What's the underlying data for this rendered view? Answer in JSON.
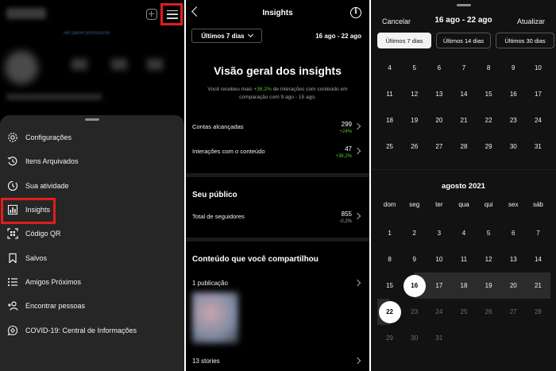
{
  "menu": {
    "items": [
      {
        "label": "Configurações",
        "icon": "settings-icon"
      },
      {
        "label": "Itens Arquivados",
        "icon": "archive-icon"
      },
      {
        "label": "Sua atividade",
        "icon": "activity-icon"
      },
      {
        "label": "Insights",
        "icon": "insights-icon"
      },
      {
        "label": "Código QR",
        "icon": "qr-code-icon"
      },
      {
        "label": "Salvos",
        "icon": "bookmark-icon"
      },
      {
        "label": "Amigos Próximos",
        "icon": "close-friends-icon"
      },
      {
        "label": "Encontrar pessoas",
        "icon": "add-person-icon"
      },
      {
        "label": "COVID-19: Central de Informações",
        "icon": "covid-info-icon"
      }
    ]
  },
  "insights": {
    "title": "Insights",
    "range_button": "Últimos 7 dias",
    "range_dates": "16 ago - 22 ago",
    "overview_title": "Visão geral dos insights",
    "overview_desc_pre": "Você recebeu mais ",
    "overview_desc_pct": "+38,2%",
    "overview_desc_post": " de interações com conteúdo em comparação com 9 ago - 15 ago.",
    "accounts_reached": {
      "label": "Contas alcançadas",
      "value": "299",
      "delta": "+24%"
    },
    "content_interactions": {
      "label": "Interações com o conteúdo",
      "value": "47",
      "delta": "+38,2%"
    },
    "audience_title": "Seu público",
    "followers": {
      "label": "Total de seguidores",
      "value": "855",
      "delta": "-0,2%"
    },
    "shared_title": "Conteúdo que você compartilhou",
    "posts_label": "1 publicação",
    "stories_label": "13 stories"
  },
  "date_picker": {
    "cancel": "Cancelar",
    "range": "16 ago - 22 ago",
    "update": "Atualizar",
    "chips": [
      "Últimos 7 dias",
      "Últimos 14 dias",
      "Últimos 30 dias"
    ],
    "prev_month_days": [
      "4",
      "5",
      "6",
      "7",
      "8",
      "9",
      "10",
      "11",
      "12",
      "13",
      "14",
      "15",
      "16",
      "17",
      "18",
      "19",
      "20",
      "21",
      "22",
      "23",
      "24",
      "25",
      "26",
      "27",
      "28",
      "29",
      "30",
      "31"
    ],
    "month_title": "agosto 2021",
    "weekdays": [
      "dom",
      "seg",
      "ter",
      "qua",
      "qui",
      "sex",
      "sáb"
    ],
    "days": [
      "1",
      "2",
      "3",
      "4",
      "5",
      "6",
      "7",
      "8",
      "9",
      "10",
      "11",
      "12",
      "13",
      "14",
      "15",
      "16",
      "17",
      "18",
      "19",
      "20",
      "21",
      "22",
      "23",
      "24",
      "25",
      "26",
      "27",
      "28",
      "29",
      "30",
      "31"
    ],
    "selected_start": "16",
    "selected_end": "22"
  }
}
